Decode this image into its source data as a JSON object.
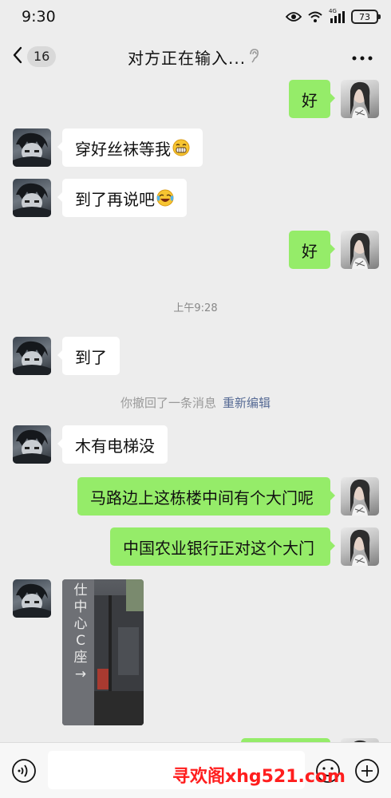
{
  "status_bar": {
    "time": "9:30",
    "network_label": "4G",
    "battery": "73",
    "icons": [
      "eye-icon",
      "wifi-icon",
      "signal-icon",
      "battery-icon"
    ]
  },
  "nav": {
    "unread_count": "16",
    "title": "对方正在输入...",
    "icons": [
      "back-chevron-icon",
      "ear-icon",
      "more-icon"
    ]
  },
  "messages": [
    {
      "side": "right",
      "text": "好"
    },
    {
      "side": "left",
      "text": "穿好丝袜等我",
      "emoji": "grin-emoji"
    },
    {
      "side": "left",
      "text": "到了再说吧",
      "emoji": "laugh-cry-emoji"
    },
    {
      "side": "right",
      "text": "好"
    },
    {
      "side": "left",
      "text": "到了"
    },
    {
      "side": "left",
      "text": "木有电梯没"
    },
    {
      "side": "right",
      "text": "马路边上这栋楼中间有个大门呢"
    },
    {
      "side": "right",
      "text": "中国农业银行正对这个大门"
    }
  ],
  "timestamp": "上午9:28",
  "recall": {
    "text": "你撤回了一条消息",
    "edit_label": "重新编辑"
  },
  "photo": {
    "caption": "仕中心C座→"
  },
  "input_bar": {
    "placeholder": "",
    "icons": [
      "voice-icon",
      "emoji-icon",
      "plus-icon"
    ]
  },
  "watermark": "寻欢阁xhg521.com",
  "colors": {
    "background": "#ededed",
    "my_bubble": "#95ec69",
    "their_bubble": "#ffffff",
    "link": "#576b95",
    "watermark": "#ff1e1e"
  }
}
